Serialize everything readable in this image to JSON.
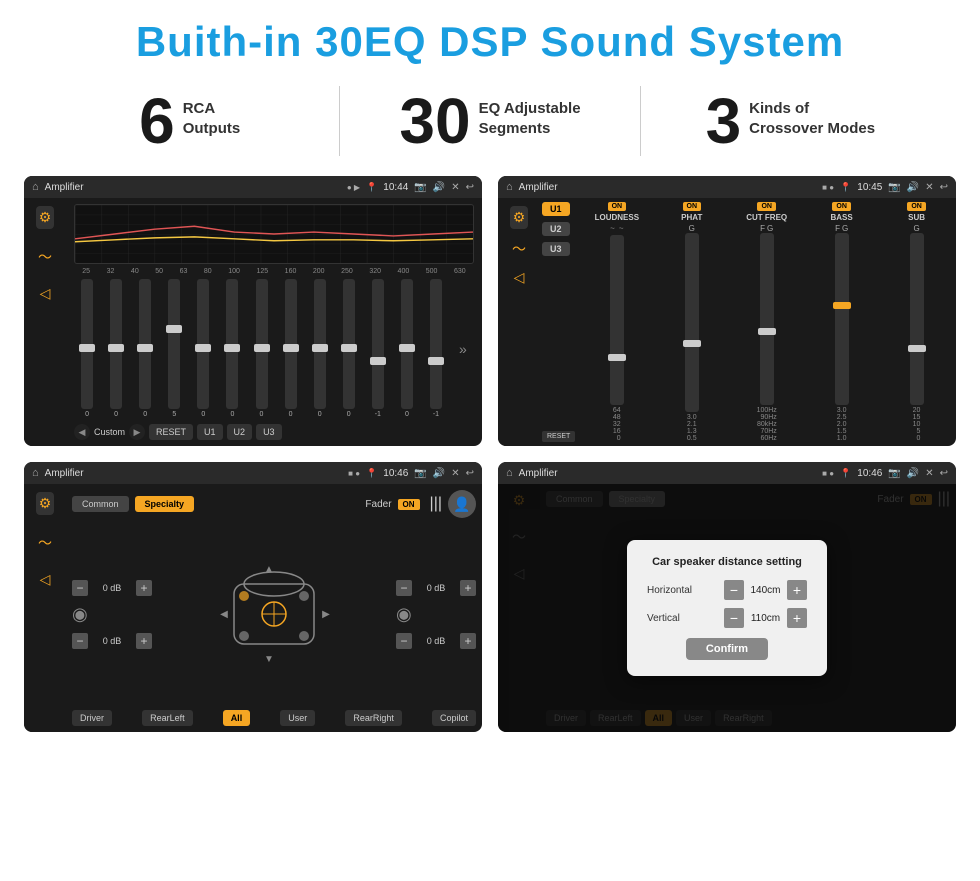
{
  "header": {
    "title": "Buith-in 30EQ DSP Sound System"
  },
  "stats": [
    {
      "number": "6",
      "label": "RCA\nOutputs"
    },
    {
      "number": "30",
      "label": "EQ Adjustable\nSegments"
    },
    {
      "number": "3",
      "label": "Kinds of\nCrossover Modes"
    }
  ],
  "screens": [
    {
      "id": "screen1",
      "statusBar": {
        "title": "Amplifier",
        "time": "10:44"
      },
      "type": "eq",
      "presets": [
        "Custom",
        "RESET",
        "U1",
        "U2",
        "U3"
      ],
      "freqLabels": [
        "25",
        "32",
        "40",
        "50",
        "63",
        "80",
        "100",
        "125",
        "160",
        "200",
        "250",
        "320",
        "400",
        "500",
        "630"
      ],
      "sliderValues": [
        "0",
        "0",
        "0",
        "5",
        "0",
        "0",
        "0",
        "0",
        "0",
        "0",
        "-1",
        "0",
        "-1"
      ]
    },
    {
      "id": "screen2",
      "statusBar": {
        "title": "Amplifier",
        "time": "10:45"
      },
      "type": "crossover",
      "uButtons": [
        "U1",
        "U2",
        "U3"
      ],
      "channels": [
        "LOUDNESS",
        "PHAT",
        "CUT FREQ",
        "BASS",
        "SUB"
      ],
      "resetLabel": "RESET"
    },
    {
      "id": "screen3",
      "statusBar": {
        "title": "Amplifier",
        "time": "10:46"
      },
      "type": "fader",
      "modes": [
        "Common",
        "Specialty"
      ],
      "faderLabel": "Fader",
      "positions": [
        "Driver",
        "RearLeft",
        "All",
        "User",
        "RearRight",
        "Copilot"
      ],
      "dbValues": [
        "0 dB",
        "0 dB",
        "0 dB",
        "0 dB"
      ]
    },
    {
      "id": "screen4",
      "statusBar": {
        "title": "Amplifier",
        "time": "10:46"
      },
      "type": "dialog",
      "dialog": {
        "title": "Car speaker distance setting",
        "rows": [
          {
            "label": "Horizontal",
            "value": "140cm"
          },
          {
            "label": "Vertical",
            "value": "110cm"
          }
        ],
        "confirmLabel": "Confirm"
      }
    }
  ]
}
